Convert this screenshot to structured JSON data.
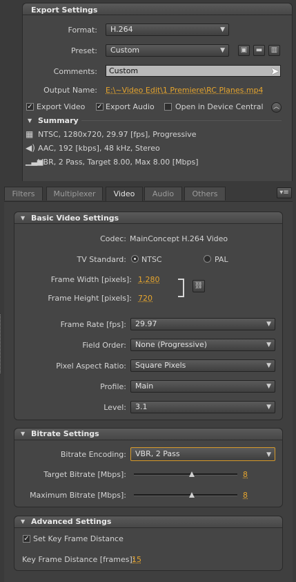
{
  "export": {
    "title": "Export Settings",
    "format_label": "Format:",
    "format_value": "H.264",
    "preset_label": "Preset:",
    "preset_value": "Custom",
    "comments_label": "Comments:",
    "comments_value": "Custom",
    "output_label": "Output Name:",
    "output_value": "E:\\~Video Edit\\1 Premiere\\RC Planes.mp4",
    "export_video_label": "Export Video",
    "export_audio_label": "Export Audio",
    "device_central_label": "Open in Device Central",
    "export_video_checked": true,
    "export_audio_checked": true,
    "device_central_checked": false
  },
  "summary": {
    "title": "Summary",
    "video": "NTSC, 1280x720, 29.97 [fps], Progressive",
    "audio": "AAC, 192 [kbps], 48 kHz, Stereo",
    "bitrate": "VBR, 2 Pass, Target 8.00, Max 8.00 [Mbps]"
  },
  "tabs": [
    "Filters",
    "Multiplexer",
    "Video",
    "Audio",
    "Others"
  ],
  "active_tab": "Video",
  "basic": {
    "title": "Basic Video Settings",
    "codec_label": "Codec:",
    "codec_value": "MainConcept H.264 Video",
    "tv_label": "TV Standard:",
    "ntsc": "NTSC",
    "pal": "PAL",
    "tv_selected": "NTSC",
    "width_label": "Frame Width [pixels]:",
    "width_value": "1,280",
    "height_label": "Frame Height [pixels]:",
    "height_value": "720",
    "framerate_label": "Frame Rate [fps]:",
    "framerate_value": "29.97",
    "field_label": "Field Order:",
    "field_value": "None (Progressive)",
    "par_label": "Pixel Aspect Ratio:",
    "par_value": "Square Pixels",
    "profile_label": "Profile:",
    "profile_value": "Main",
    "level_label": "Level:",
    "level_value": "3.1"
  },
  "bitrate": {
    "title": "Bitrate Settings",
    "encoding_label": "Bitrate Encoding:",
    "encoding_value": "VBR, 2 Pass",
    "target_label": "Target Bitrate [Mbps]:",
    "target_value": "8",
    "target_fraction": 0.53,
    "max_label": "Maximum Bitrate [Mbps]:",
    "max_value": "8",
    "max_fraction": 0.53
  },
  "advanced": {
    "title": "Advanced Settings",
    "keyframe_cb_label": "Set Key Frame Distance",
    "keyframe_checked": true,
    "keyframe_label": "Key Frame Distance [frames]:",
    "keyframe_value": "15"
  },
  "colors": {
    "accent": "#e6a52e",
    "panel": "#454545",
    "background": "#3a3a3a"
  }
}
